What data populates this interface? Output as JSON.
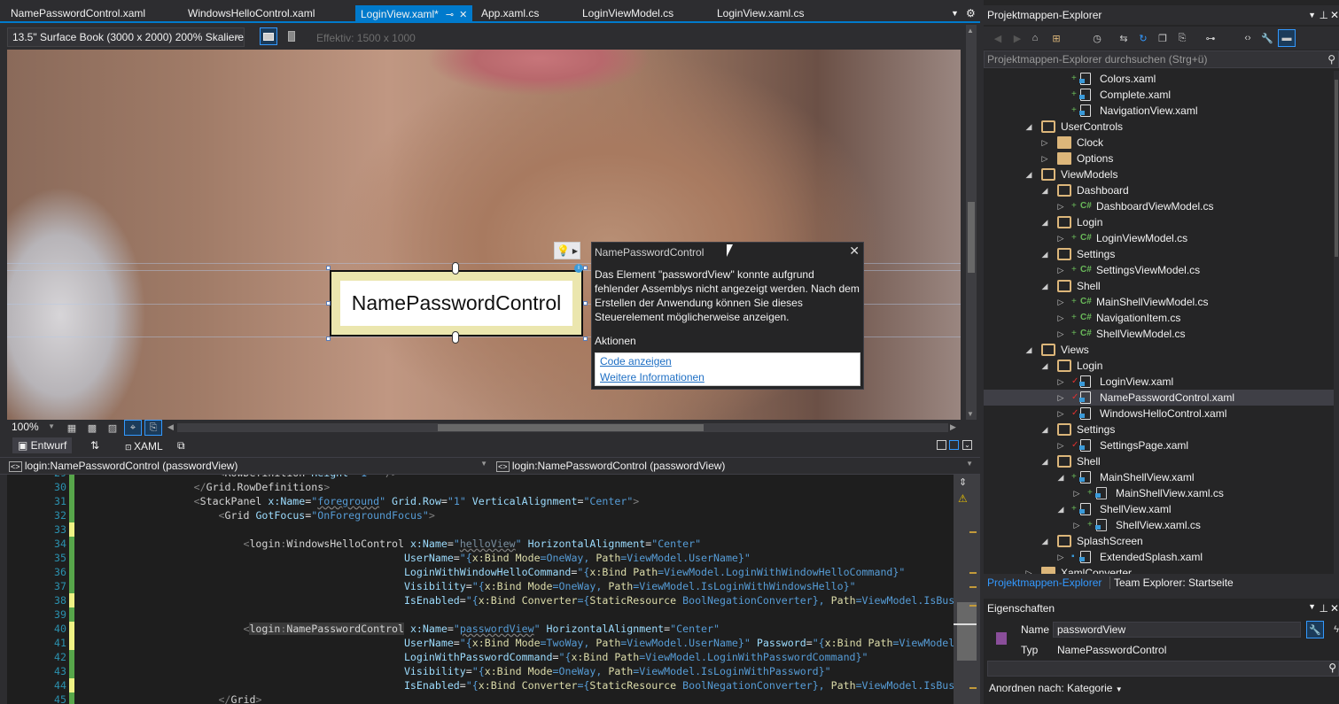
{
  "editor_tabs": [
    {
      "label": "NamePasswordControl.xaml",
      "active": false
    },
    {
      "label": "WindowsHelloControl.xaml",
      "active": false
    },
    {
      "label": "LoginView.xaml*",
      "active": true
    },
    {
      "label": "App.xaml.cs",
      "active": false
    },
    {
      "label": "LoginViewModel.cs",
      "active": false
    },
    {
      "label": "LoginView.xaml.cs",
      "active": false
    }
  ],
  "designer_toolbar": {
    "device": "13.5\" Surface Book (3000 x 2000) 200% Skaliere",
    "effective": "Effektiv: 1500 x 1000"
  },
  "designer": {
    "control_label": "NamePasswordControl",
    "popup": {
      "title": "NamePasswordControl",
      "message": "Das Element \"passwordView\" konnte aufgrund fehlender Assemblys nicht angezeigt werden. Nach dem Erstellen der Anwendung können Sie dieses Steuerelement möglicherweise anzeigen.",
      "actions_label": "Aktionen",
      "links": [
        "Code anzeigen",
        "Weitere Informationen"
      ]
    },
    "zoom": "100%"
  },
  "split_tabs": {
    "design": "Entwurf",
    "xaml": "XAML"
  },
  "nav": {
    "left": "login:NamePasswordControl (passwordView)",
    "right": "login:NamePasswordControl (passwordView)"
  },
  "code_lines": [
    {
      "n": "30",
      "g": "g"
    },
    {
      "n": "31",
      "g": "g"
    },
    {
      "n": "32",
      "g": "g"
    },
    {
      "n": "33",
      "g": "y"
    },
    {
      "n": "34",
      "g": "g"
    },
    {
      "n": "35",
      "g": "g"
    },
    {
      "n": "36",
      "g": "g"
    },
    {
      "n": "37",
      "g": "g"
    },
    {
      "n": "38",
      "g": "y"
    },
    {
      "n": "39",
      "g": "g"
    },
    {
      "n": "40",
      "g": "y"
    },
    {
      "n": "41",
      "g": "y"
    },
    {
      "n": "42",
      "g": "g"
    },
    {
      "n": "43",
      "g": "g"
    },
    {
      "n": "44",
      "g": "y"
    },
    {
      "n": "45",
      "g": "g"
    }
  ],
  "code": {
    "l30": "</Grid.RowDefinitions>",
    "l31a": "<StackPanel ",
    "l31b": "x:Name=",
    "l31c": "\"",
    "l31d": "foreground",
    "l31e": "\" ",
    "l31f": "Grid.Row=",
    "l31g": "\"1\" ",
    "l31h": "VerticalAlignment=",
    "l31i": "\"Center\"",
    ">": ">",
    "l32a": "<Grid ",
    "l32b": "GotFocus=",
    "l32c": "\"OnForegroundFocus\"",
    "l34a": "<login:WindowsHelloControl ",
    "l34b": "x:Name=",
    "l34c": "\"",
    "l34d": "helloView",
    "l34e": "\" ",
    "l34f": "HorizontalAlignment=",
    "l34g": "\"Center\"",
    "l35": "UserName=\"{x:Bind Mode=OneWay, Path=ViewModel.UserName}\"",
    "l36": "LoginWithWindowHelloCommand=\"{x:Bind Path=ViewModel.LoginWithWindowHelloCommand}\"",
    "l37": "Visibility=\"{x:Bind Mode=OneWay, Path=ViewModel.IsLoginWithWindowsHello}\"",
    "l38": "IsEnabled=\"{x:Bind Converter={StaticResource BoolNegationConverter}, Path=ViewModel.IsBusy}\" />",
    "l40a": "<login:NamePasswordControl ",
    "l40b": "x:Name=",
    "l40c": "\"",
    "l40d": "passwordView",
    "l40e": "\" ",
    "l40f": "HorizontalAlignment=",
    "l40g": "\"Center\"",
    "l41": "UserName=\"{x:Bind Mode=TwoWay, Path=ViewModel.UserName}\" Password=\"{x:Bind Path=ViewModel.Password",
    "l42": "LoginWithPasswordCommand=\"{x:Bind Path=ViewModel.LoginWithPasswordCommand}\"",
    "l43": "Visibility=\"{x:Bind Mode=OneWay, Path=ViewModel.IsLoginWithPassword}\"",
    "l44": "IsEnabled=\"{x:Bind Converter={StaticResource BoolNegationConverter}, Path=ViewModel.IsBusy}\" />",
    "l45": "</Grid>"
  },
  "solution_explorer": {
    "title": "Projektmappen-Explorer",
    "search_placeholder": "Projektmappen-Explorer durchsuchen (Strg+ü)",
    "items": [
      {
        "label": "Colors.xaml",
        "type": "xaml",
        "mark": "+",
        "level": 4,
        "exp": ""
      },
      {
        "label": "Complete.xaml",
        "type": "xaml",
        "mark": "+",
        "level": 4,
        "exp": ""
      },
      {
        "label": "NavigationView.xaml",
        "type": "xaml",
        "mark": "+",
        "level": 4,
        "exp": ""
      },
      {
        "label": "UserControls",
        "type": "folder-open",
        "mark": "",
        "level": 2,
        "exp": "open"
      },
      {
        "label": "Clock",
        "type": "folder",
        "mark": "",
        "level": 3,
        "exp": "closed"
      },
      {
        "label": "Options",
        "type": "folder",
        "mark": "",
        "level": 3,
        "exp": "closed"
      },
      {
        "label": "ViewModels",
        "type": "folder-open",
        "mark": "",
        "level": 2,
        "exp": "open"
      },
      {
        "label": "Dashboard",
        "type": "folder-open",
        "mark": "",
        "level": 3,
        "exp": "open"
      },
      {
        "label": "DashboardViewModel.cs",
        "type": "cs",
        "mark": "+",
        "level": 4,
        "exp": "closed"
      },
      {
        "label": "Login",
        "type": "folder-open",
        "mark": "",
        "level": 3,
        "exp": "open"
      },
      {
        "label": "LoginViewModel.cs",
        "type": "cs",
        "mark": "+",
        "level": 4,
        "exp": "closed"
      },
      {
        "label": "Settings",
        "type": "folder-open",
        "mark": "",
        "level": 3,
        "exp": "open"
      },
      {
        "label": "SettingsViewModel.cs",
        "type": "cs",
        "mark": "+",
        "level": 4,
        "exp": "closed"
      },
      {
        "label": "Shell",
        "type": "folder-open",
        "mark": "",
        "level": 3,
        "exp": "open"
      },
      {
        "label": "MainShellViewModel.cs",
        "type": "cs",
        "mark": "+",
        "level": 4,
        "exp": "closed"
      },
      {
        "label": "NavigationItem.cs",
        "type": "cs",
        "mark": "+",
        "level": 4,
        "exp": "closed"
      },
      {
        "label": "ShellViewModel.cs",
        "type": "cs",
        "mark": "+",
        "level": 4,
        "exp": "closed"
      },
      {
        "label": "Views",
        "type": "folder-open",
        "mark": "",
        "level": 2,
        "exp": "open"
      },
      {
        "label": "Login",
        "type": "folder-open",
        "mark": "",
        "level": 3,
        "exp": "open"
      },
      {
        "label": "LoginView.xaml",
        "type": "xaml",
        "mark": "✓",
        "level": 4,
        "exp": "closed"
      },
      {
        "label": "NamePasswordControl.xaml",
        "type": "xaml",
        "mark": "✓",
        "level": 4,
        "exp": "closed",
        "selected": true
      },
      {
        "label": "WindowsHelloControl.xaml",
        "type": "xaml",
        "mark": "✓",
        "level": 4,
        "exp": "closed"
      },
      {
        "label": "Settings",
        "type": "folder-open",
        "mark": "",
        "level": 3,
        "exp": "open"
      },
      {
        "label": "SettingsPage.xaml",
        "type": "xaml",
        "mark": "✓",
        "level": 4,
        "exp": "closed"
      },
      {
        "label": "Shell",
        "type": "folder-open",
        "mark": "",
        "level": 3,
        "exp": "open"
      },
      {
        "label": "MainShellView.xaml",
        "type": "xaml",
        "mark": "+",
        "level": 4,
        "exp": "open"
      },
      {
        "label": "MainShellView.xaml.cs",
        "type": "xamlcs",
        "mark": "+",
        "level": 5,
        "exp": "closed"
      },
      {
        "label": "ShellView.xaml",
        "type": "xaml",
        "mark": "+",
        "level": 4,
        "exp": "open"
      },
      {
        "label": "ShellView.xaml.cs",
        "type": "xamlcs",
        "mark": "+",
        "level": 5,
        "exp": "closed"
      },
      {
        "label": "SplashScreen",
        "type": "folder-open",
        "mark": "",
        "level": 3,
        "exp": "open"
      },
      {
        "label": "ExtendedSplash.xaml",
        "type": "xaml",
        "mark": "🔒",
        "level": 4,
        "exp": "closed"
      },
      {
        "label": "XamlConverter",
        "type": "folder",
        "mark": "",
        "level": 2,
        "exp": "closed"
      }
    ],
    "bottom_tabs": [
      "Projektmappen-Explorer",
      "Team Explorer: Startseite"
    ]
  },
  "properties": {
    "title": "Eigenschaften",
    "name_label": "Name",
    "name_value": "passwordView",
    "type_label": "Typ",
    "type_value": "NamePasswordControl",
    "arrange_label": "Anordnen nach: Kategorie"
  }
}
